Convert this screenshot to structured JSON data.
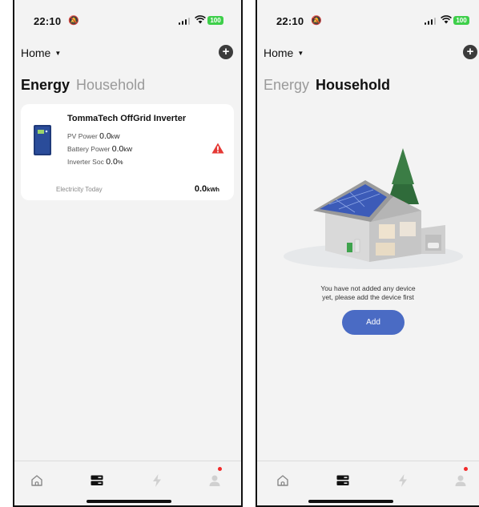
{
  "left_screen": {
    "status": {
      "time": "22:10",
      "battery": "100"
    },
    "home_selector": "Home",
    "tabs": {
      "energy": "Energy",
      "household": "Household",
      "active": "energy"
    },
    "device_card": {
      "name": "TommaTech OffGrid Inverter",
      "pv_power_label": "PV Power",
      "pv_power_value": "0.0",
      "pv_power_unit": "kW",
      "battery_power_label": "Battery Power",
      "battery_power_value": "0.0",
      "battery_power_unit": "kW",
      "inverter_soc_label": "Inverter Soc",
      "inverter_soc_value": "0.0",
      "inverter_soc_unit": "%",
      "electricity_today_label": "Electricity Today",
      "electricity_today_value": "0.0",
      "electricity_today_unit": "kWh",
      "status_icon": "warning-icon"
    }
  },
  "right_screen": {
    "status": {
      "time": "22:10",
      "battery": "100"
    },
    "home_selector": "Home",
    "tabs": {
      "energy": "Energy",
      "household": "Household",
      "active": "household"
    },
    "empty_state": {
      "message_line1": "You have not added any device",
      "message_line2": "yet, please add the device first",
      "add_button": "Add"
    }
  },
  "tabbar": {
    "items": [
      "home-icon",
      "devices-icon",
      "energy-icon",
      "profile-icon"
    ],
    "active": "devices-icon"
  },
  "colors": {
    "accent": "#4a6bc4",
    "warning": "#e53935",
    "badge": "#f22a2a",
    "battery": "#3ecf4a"
  }
}
